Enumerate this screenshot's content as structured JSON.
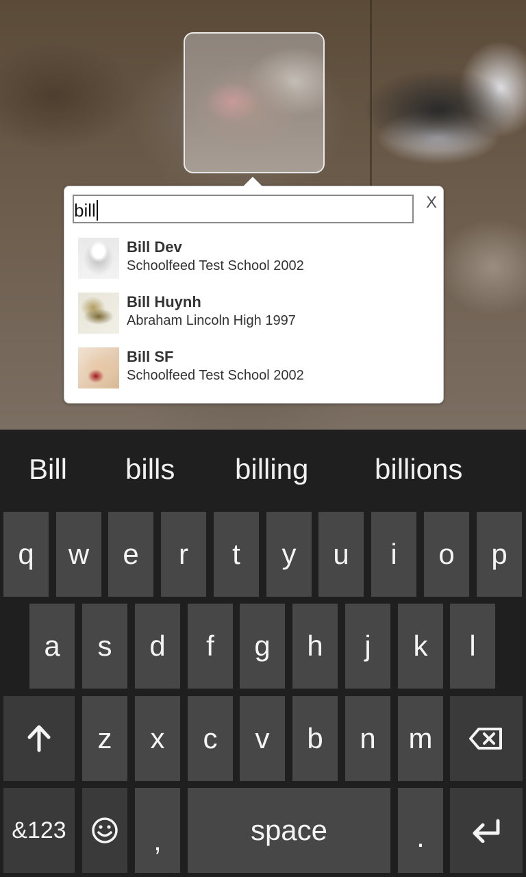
{
  "search": {
    "value": "bill",
    "clear_label": "X"
  },
  "results": [
    {
      "name": "Bill Dev",
      "school": "Schoolfeed Test School 2002",
      "avatar": "sketch-portrait"
    },
    {
      "name": "Bill Huynh",
      "school": "Abraham Lincoln High 1997",
      "avatar": "dragon-drawing"
    },
    {
      "name": "Bill SF",
      "school": "Schoolfeed Test School 2002",
      "avatar": "puppy-photo"
    }
  ],
  "keyboard": {
    "suggestions": [
      "Bill",
      "bills",
      "billing",
      "billions"
    ],
    "row1": [
      "q",
      "w",
      "e",
      "r",
      "t",
      "y",
      "u",
      "i",
      "o",
      "p"
    ],
    "row2": [
      "a",
      "s",
      "d",
      "f",
      "g",
      "h",
      "j",
      "k",
      "l"
    ],
    "row3": [
      "z",
      "x",
      "c",
      "v",
      "b",
      "n",
      "m"
    ],
    "shift_icon": "shift-up-arrow-icon",
    "backspace_icon": "backspace-icon",
    "numbers_label": "&123",
    "emoji_icon": "smiley-icon",
    "comma_label": ",",
    "space_label": "space",
    "period_label": ".",
    "enter_icon": "enter-arrow-icon"
  }
}
